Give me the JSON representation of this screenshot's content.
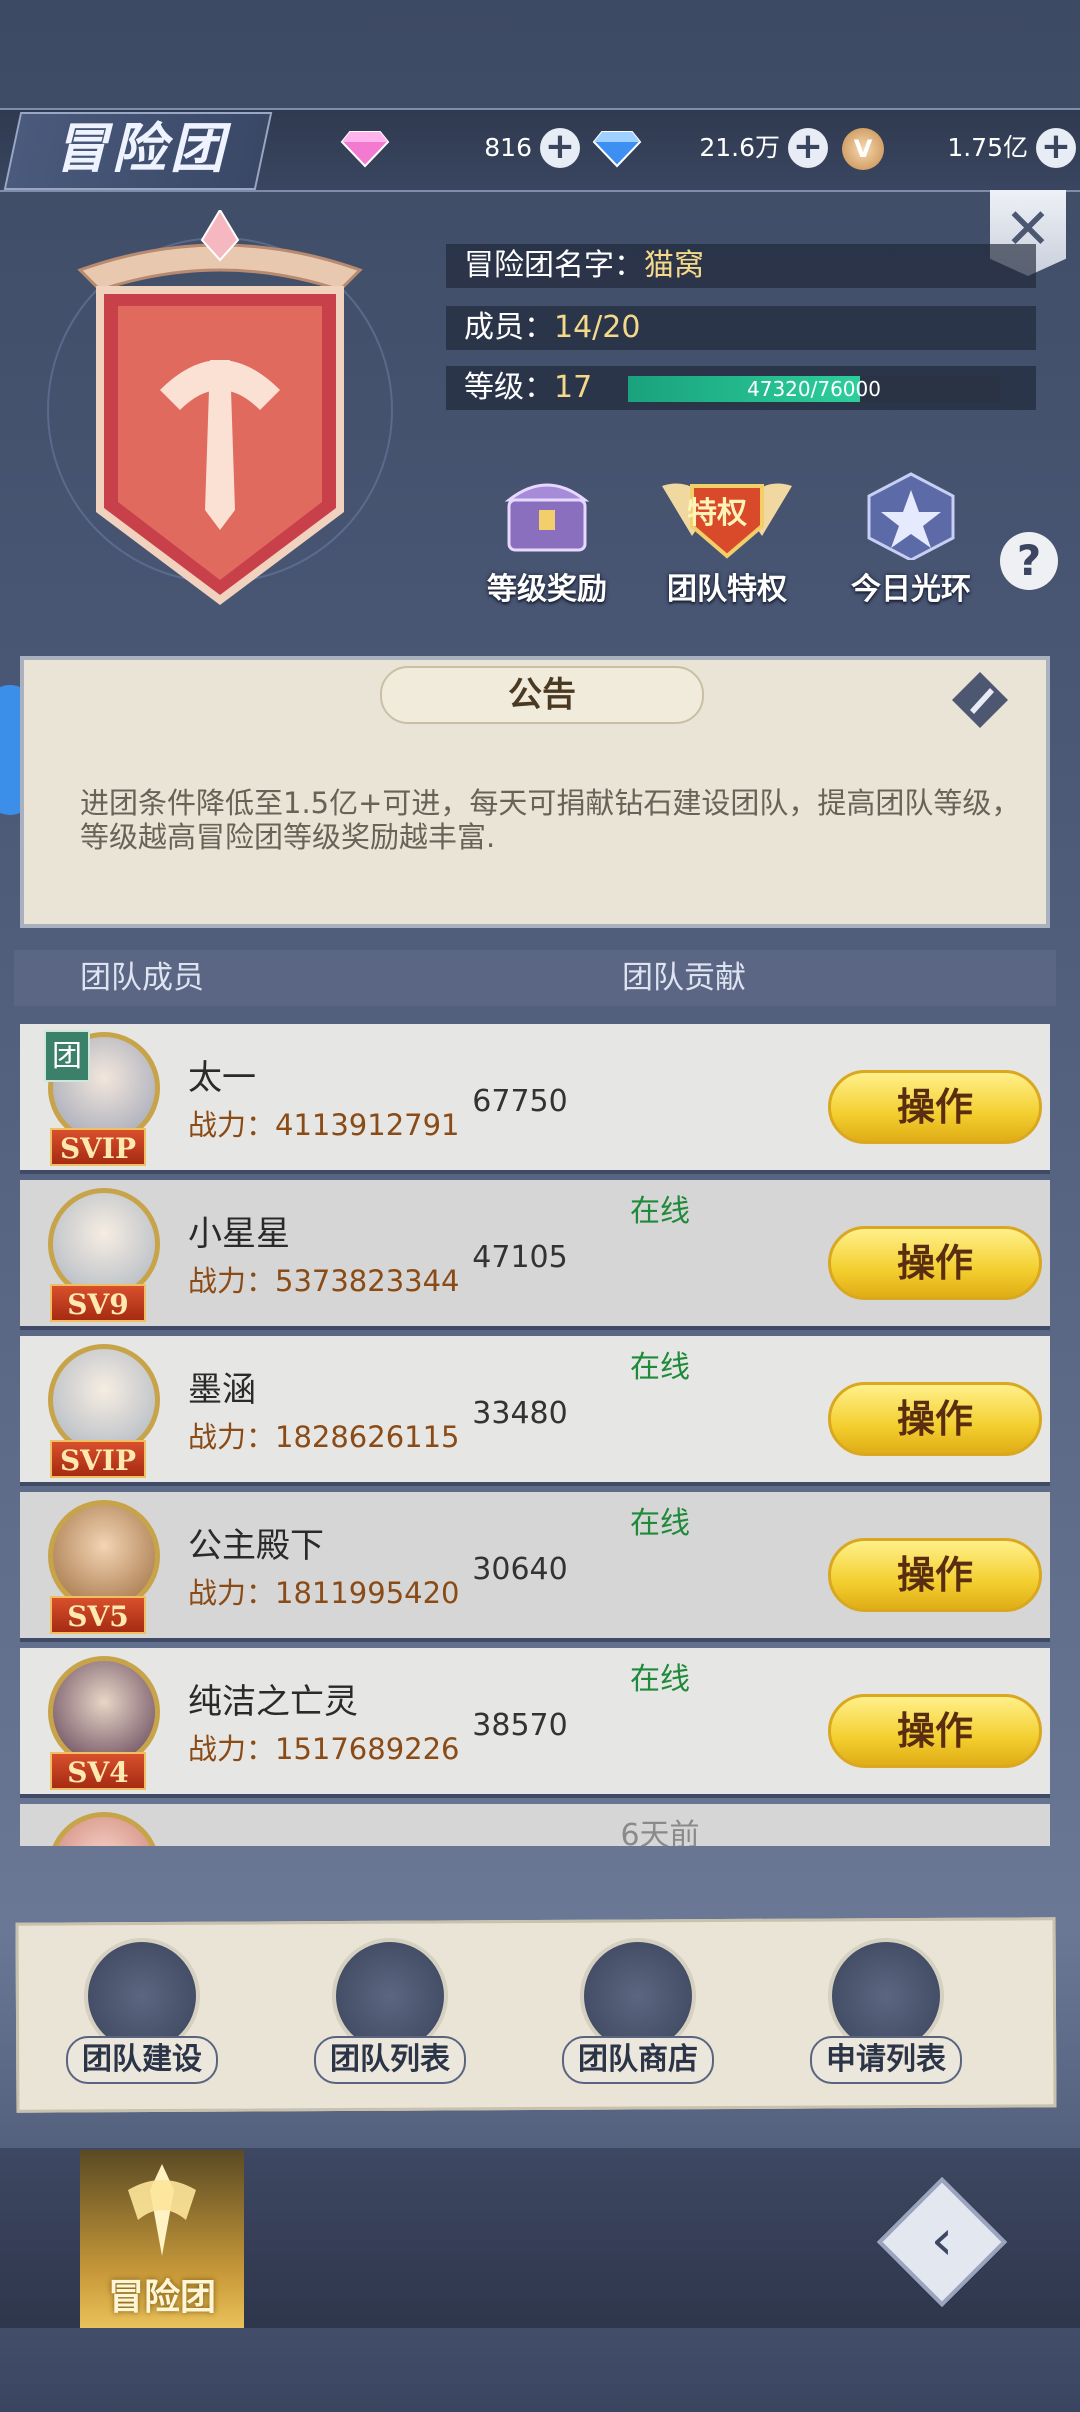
{
  "header": {
    "title": "冒险团",
    "currencies": [
      {
        "icon": "pink-diamond-icon",
        "amount": "816"
      },
      {
        "icon": "blue-diamond-icon",
        "amount": "21.6万"
      },
      {
        "icon": "gold-coin-icon",
        "amount": "1.75亿"
      }
    ]
  },
  "guild": {
    "name_label": "冒险团名字：",
    "name_value": "猫窝",
    "members_label": "成员：",
    "members_value": "14/20",
    "level_label": "等级：",
    "level_value": "17",
    "xp_text": "47320/76000",
    "xp_progress": 0.6226
  },
  "features": [
    {
      "label": "等级奖励",
      "icon": "treasure-chest-icon"
    },
    {
      "label": "团队特权",
      "icon": "privilege-badge-icon",
      "badge_text": "特权"
    },
    {
      "label": "今日光环",
      "icon": "star-halo-icon"
    }
  ],
  "notice": {
    "title": "公告",
    "text": "进团条件降低至1.5亿+可进，每天可捐献钻石建设团队，提高团队等级，等级越高冒险团等级奖励越丰富."
  },
  "members_header": {
    "col_members": "团队成员",
    "col_contribution": "团队贡献"
  },
  "members": [
    {
      "name": "太一",
      "power": "战力：4113912791",
      "contribution": "67750",
      "vip": "SVIP",
      "status": "",
      "leader_tag": "团",
      "op": "操作"
    },
    {
      "name": "小星星",
      "power": "战力：5373823344",
      "contribution": "47105",
      "vip": "SV9",
      "status": "在线",
      "op": "操作"
    },
    {
      "name": "墨涵",
      "power": "战力：1828626115",
      "contribution": "33480",
      "vip": "SVIP",
      "status": "在线",
      "op": "操作"
    },
    {
      "name": "公主殿下",
      "power": "战力：1811995420",
      "contribution": "30640",
      "vip": "SV5",
      "status": "在线",
      "op": "操作"
    },
    {
      "name": "纯洁之亡灵",
      "power": "战力：1517689226",
      "contribution": "38570",
      "vip": "SV4",
      "status": "在线",
      "op": "操作"
    },
    {
      "status": "6天前"
    }
  ],
  "menu": [
    {
      "label": "团队建设",
      "icon": "team-build-icon"
    },
    {
      "label": "团队列表",
      "icon": "team-list-icon"
    },
    {
      "label": "团队商店",
      "icon": "shop-icon"
    },
    {
      "label": "申请列表",
      "icon": "application-list-icon"
    }
  ],
  "nav": {
    "active_label": "冒险团"
  },
  "colors": {
    "accent_gold": "#f3cf2f",
    "online_green": "#1f8a3a",
    "xp_green": "#2ccf9b"
  }
}
